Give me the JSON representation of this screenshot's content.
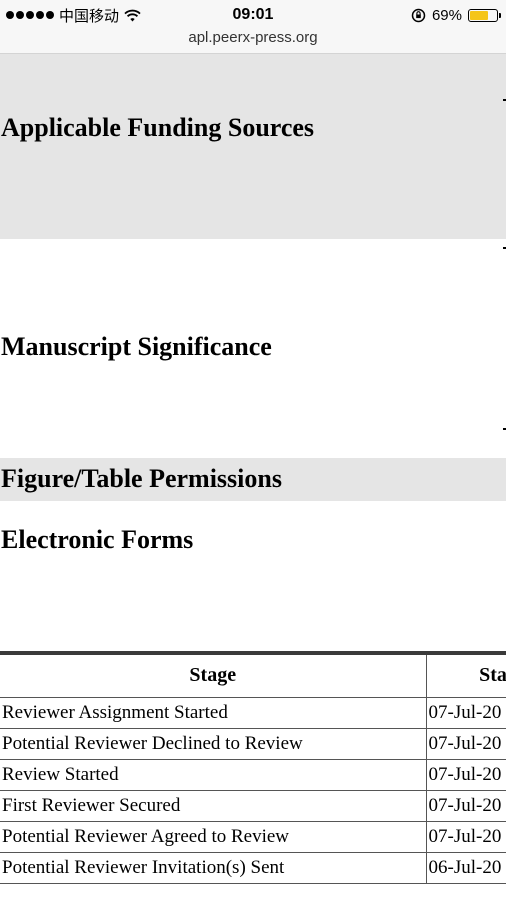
{
  "status_bar": {
    "carrier": "中国移动",
    "time": "09:01",
    "battery_percent": "69%",
    "battery_level": 0.69,
    "battery_color": "#f5c518",
    "url": "apl.peerx-press.org"
  },
  "sections": [
    {
      "title": "Applicable Funding Sources"
    },
    {
      "title": "Manuscript Significance"
    },
    {
      "title": "Figure/Table Permissions"
    },
    {
      "title": "Electronic Forms"
    }
  ],
  "history_table": {
    "columns": [
      "Stage",
      "Sta"
    ],
    "rows": [
      {
        "stage": "Reviewer Assignment Started",
        "date": "07-Jul-20"
      },
      {
        "stage": "Potential Reviewer Declined to Review",
        "date": "07-Jul-20"
      },
      {
        "stage": "Review Started",
        "date": "07-Jul-20"
      },
      {
        "stage": "First Reviewer Secured",
        "date": "07-Jul-20"
      },
      {
        "stage": "Potential Reviewer Agreed to Review",
        "date": "07-Jul-20"
      },
      {
        "stage": "Potential Reviewer Invitation(s) Sent",
        "date": "06-Jul-20"
      }
    ]
  }
}
